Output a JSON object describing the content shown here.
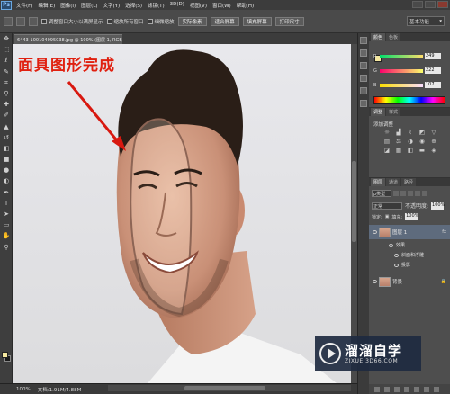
{
  "app": {
    "logo": "Ps"
  },
  "menu": [
    "文件(F)",
    "编辑(E)",
    "图像(I)",
    "图层(L)",
    "文字(Y)",
    "选择(S)",
    "滤镜(T)",
    "3D(D)",
    "视图(V)",
    "窗口(W)",
    "帮助(H)"
  ],
  "options": {
    "checks": [
      "调整窗口大小以满屏显示",
      "缩放所有窗口",
      "细微缩放"
    ],
    "buttons": [
      "实际像素",
      "适合屏幕",
      "填充屏幕",
      "打印尺寸"
    ],
    "workspace": "基本功能"
  },
  "document": {
    "tab_label": "6443-100104095038.jpg @ 100% (图层 1, RGB/8#) ×"
  },
  "canvas": {
    "annotation": "面具图形完成"
  },
  "status": {
    "zoom": "100%",
    "doc_info": "文档:1.91M/4.88M"
  },
  "color_panel": {
    "tabs": [
      "颜色",
      "色板"
    ],
    "R": {
      "label": "R",
      "value": "249"
    },
    "G": {
      "label": "G",
      "value": "222"
    },
    "B": {
      "label": "B",
      "value": "107"
    },
    "foreground": "#f9de6b"
  },
  "adjust_panel": {
    "tabs": [
      "调整",
      "样式"
    ],
    "title": "添加调整"
  },
  "layers_panel": {
    "tabs": [
      "图层",
      "通道",
      "路径"
    ],
    "filter": "ρ类型",
    "blend_mode": "正常",
    "opacity_label": "不透明度:",
    "opacity": "100%",
    "lock_label": "锁定:",
    "fill_label": "填充:",
    "fill": "100%",
    "layers": [
      {
        "name": "图层 1",
        "fx": "fx",
        "effects_label": "效果",
        "effects": [
          "斜面和浮雕",
          "投影"
        ]
      },
      {
        "name": "背景"
      }
    ]
  },
  "watermark": {
    "main": "溜溜自学",
    "sub": "ZIXUE.3D66.COM"
  }
}
